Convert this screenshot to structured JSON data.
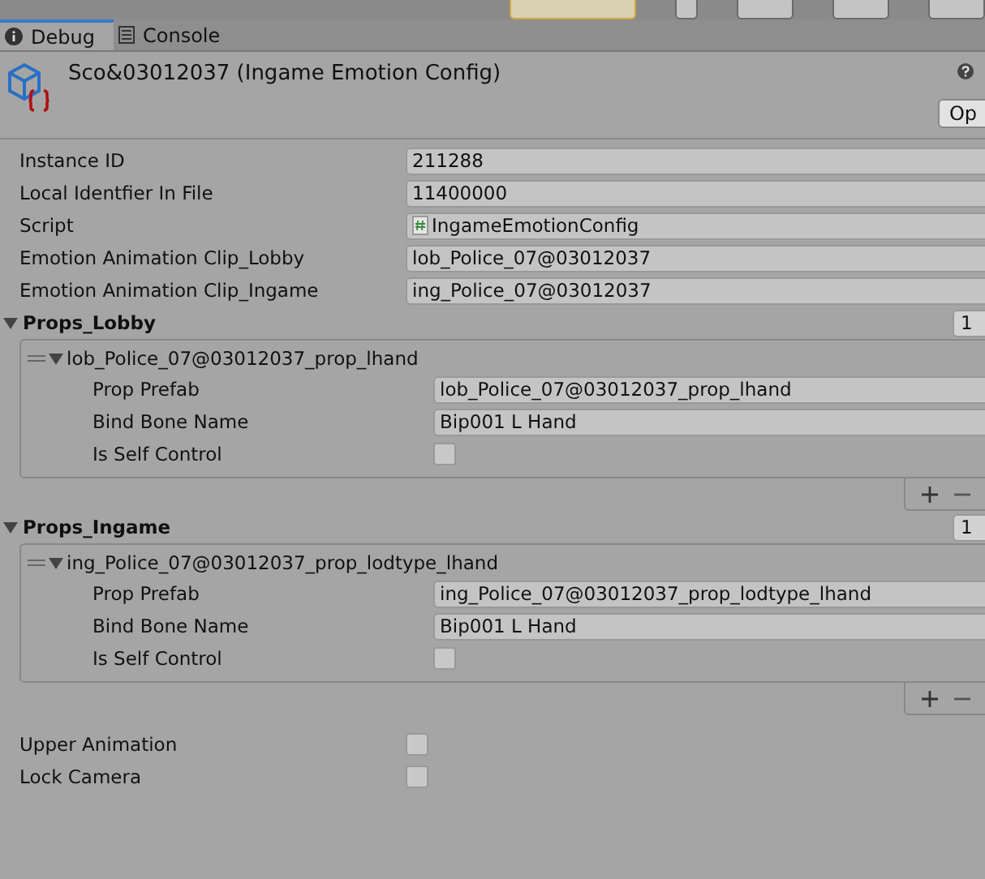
{
  "tabs": [
    {
      "kind": "info",
      "label": "Debug",
      "selected": true
    },
    {
      "kind": "console",
      "label": "Console",
      "selected": false
    }
  ],
  "header": {
    "title": "Sco&03012037 (Ingame Emotion Config)",
    "open_button": "Op"
  },
  "fields": [
    {
      "kind": "text",
      "label": "Instance ID",
      "value": "211288"
    },
    {
      "kind": "text",
      "label": "Local Identfier In File",
      "value": "11400000"
    },
    {
      "kind": "script",
      "label": "Script",
      "value": "IngameEmotionConfig"
    },
    {
      "kind": "text",
      "label": "Emotion Animation Clip_Lobby",
      "value": "lob_Police_07@03012037"
    },
    {
      "kind": "text",
      "label": "Emotion Animation Clip_Ingame",
      "value": "ing_Police_07@03012037"
    },
    {
      "kind": "array",
      "label": "Props_Lobby",
      "expanded": true,
      "size": "1",
      "elements": [
        {
          "title": "lob_Police_07@03012037_prop_lhand",
          "expanded": true,
          "fields": [
            {
              "kind": "text",
              "label": "Prop Prefab",
              "value": "lob_Police_07@03012037_prop_lhand"
            },
            {
              "kind": "text",
              "label": "Bind Bone Name",
              "value": "Bip001 L Hand"
            },
            {
              "kind": "checkbox",
              "label": "Is Self Control",
              "checked": false
            }
          ]
        }
      ]
    },
    {
      "kind": "array",
      "label": "Props_Ingame",
      "expanded": true,
      "size": "1",
      "elements": [
        {
          "title": "ing_Police_07@03012037_prop_lodtype_lhand",
          "expanded": true,
          "fields": [
            {
              "kind": "text",
              "label": "Prop Prefab",
              "value": "ing_Police_07@03012037_prop_lodtype_lhand"
            },
            {
              "kind": "text",
              "label": "Bind Bone Name",
              "value": "Bip001 L Hand"
            },
            {
              "kind": "checkbox",
              "label": "Is Self Control",
              "checked": false
            }
          ]
        }
      ]
    },
    {
      "kind": "checkbox",
      "label": "Upper Animation",
      "checked": false
    },
    {
      "kind": "checkbox",
      "label": "Lock Camera",
      "checked": false
    }
  ]
}
